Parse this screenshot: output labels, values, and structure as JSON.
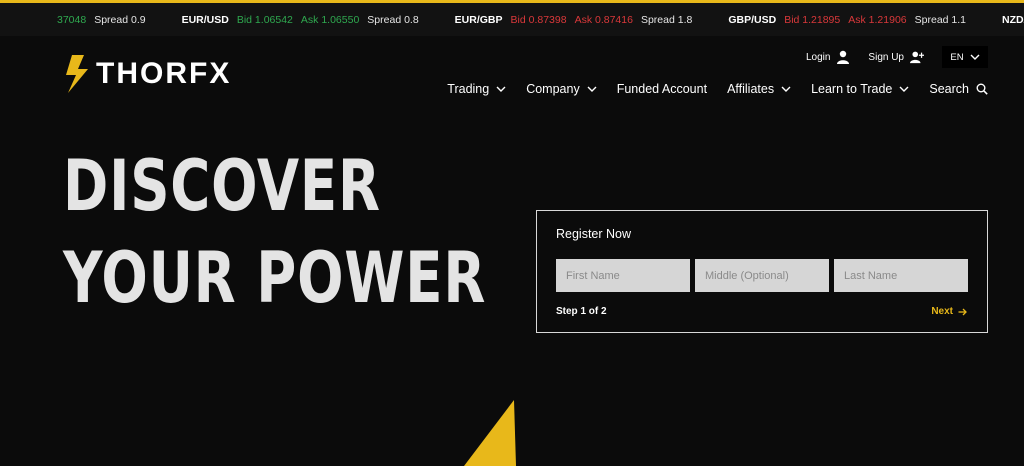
{
  "ticker": [
    {
      "pair": "",
      "bid": "",
      "ask": "37048",
      "spread": "Spread 0.9",
      "bid_color": "green",
      "ask_color": "green"
    },
    {
      "pair": "EUR/USD",
      "bid": "Bid 1.06542",
      "ask": "Ask 1.06550",
      "spread": "Spread 0.8",
      "bid_color": "green",
      "ask_color": "green"
    },
    {
      "pair": "EUR/GBP",
      "bid": "Bid 0.87398",
      "ask": "Ask 0.87416",
      "spread": "Spread 1.8",
      "bid_color": "red",
      "ask_color": "red"
    },
    {
      "pair": "GBP/USD",
      "bid": "Bid 1.21895",
      "ask": "Ask 1.21906",
      "spread": "Spread 1.1",
      "bid_color": "red",
      "ask_color": "red"
    },
    {
      "pair": "NZD/",
      "bid": "",
      "ask": "",
      "spread": "",
      "bid_color": "green",
      "ask_color": "green"
    }
  ],
  "header": {
    "logo_text": "THORFX",
    "login_label": "Login",
    "signup_label": "Sign Up",
    "language": "EN"
  },
  "nav": [
    {
      "label": "Trading",
      "dropdown": true
    },
    {
      "label": "Company",
      "dropdown": true
    },
    {
      "label": "Funded Account",
      "dropdown": false
    },
    {
      "label": "Affiliates",
      "dropdown": true
    },
    {
      "label": "Learn to Trade",
      "dropdown": true
    },
    {
      "label": "Search",
      "dropdown": false
    }
  ],
  "hero": {
    "line1": "DISCOVER",
    "line2": "YOUR POWER"
  },
  "register": {
    "title": "Register Now",
    "first_name_placeholder": "First Name",
    "middle_name_placeholder": "Middle (Optional)",
    "last_name_placeholder": "Last Name",
    "step": "Step 1 of 2",
    "next_label": "Next"
  },
  "colors": {
    "accent": "#e8b81a",
    "background": "#0b0b0b",
    "bid_green": "#2fa84f",
    "ask_red": "#d9383a"
  }
}
